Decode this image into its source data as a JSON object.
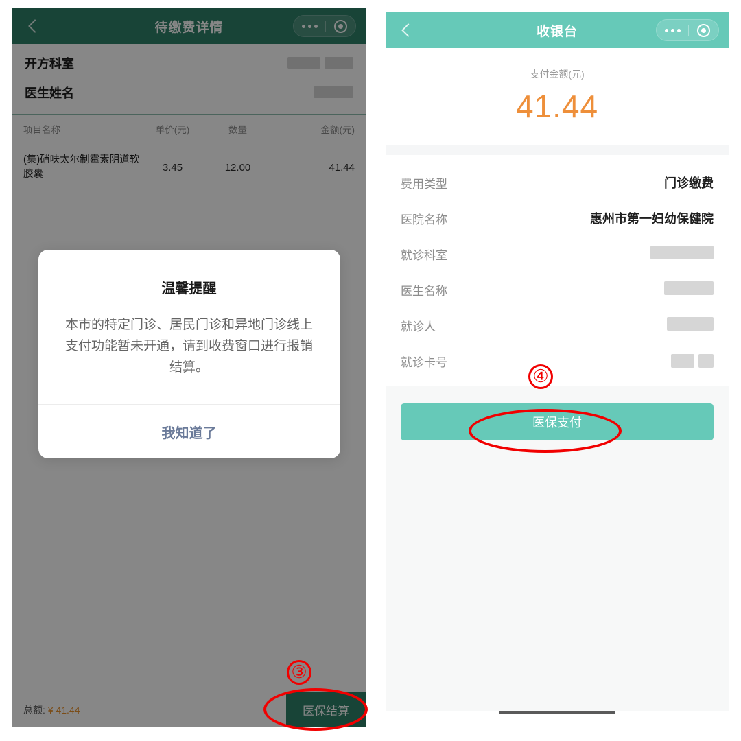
{
  "left_screen": {
    "navbar": {
      "title": "待缴费详情",
      "back_icon": "chevron-left-icon",
      "capsule": {
        "more_icon": "more-dots-icon",
        "target_icon": "target-circle-icon"
      }
    },
    "header_info": [
      {
        "label": "开方科室",
        "value": "",
        "redacted": true
      },
      {
        "label": "医生姓名",
        "value": "",
        "redacted": true
      }
    ],
    "table": {
      "columns": [
        "项目名称",
        "单价(元)",
        "数量",
        "金额(元)"
      ],
      "rows": [
        {
          "name": "(集)硝呋太尔制霉素阴道软胶囊",
          "price": "3.45",
          "qty": "12.00",
          "amount": "41.44"
        }
      ]
    },
    "bottom_bar": {
      "total_label": "总额:",
      "total_value": "¥ 41.44",
      "settle_button": "医保结算"
    },
    "modal": {
      "title": "温馨提醒",
      "body": "本市的特定门诊、居民门诊和异地门诊线上支付功能暂未开通，请到收费窗口进行报销结算。",
      "confirm_label": "我知道了"
    }
  },
  "right_screen": {
    "navbar": {
      "title": "收银台",
      "back_icon": "chevron-left-icon",
      "capsule": {
        "more_icon": "more-dots-icon",
        "target_icon": "target-circle-icon"
      }
    },
    "amount": {
      "label": "支付金额(元)",
      "value": "41.44"
    },
    "info_rows": [
      {
        "label": "费用类型",
        "value": "门诊缴费",
        "redacted": false
      },
      {
        "label": "医院名称",
        "value": "惠州市第一妇幼保健院",
        "redacted": false
      },
      {
        "label": "就诊科室",
        "value": "",
        "redacted": true
      },
      {
        "label": "医生名称",
        "value": "",
        "redacted": true
      },
      {
        "label": "就诊人",
        "value": "",
        "redacted": true
      },
      {
        "label": "就诊卡号",
        "value": "",
        "redacted": true
      }
    ],
    "pay_button": "医保支付"
  },
  "annotations": [
    {
      "marker": "③",
      "target": "医保结算",
      "shape": "ellipse"
    },
    {
      "marker": "④",
      "target": "医保支付",
      "shape": "ellipse"
    }
  ],
  "colors": {
    "left_header_green": "#2f8069",
    "right_header_teal": "#66c9b8",
    "amount_orange": "#ee8f3a",
    "annotation_red": "#f10000",
    "dialog_button_blue": "#6a7a99"
  }
}
